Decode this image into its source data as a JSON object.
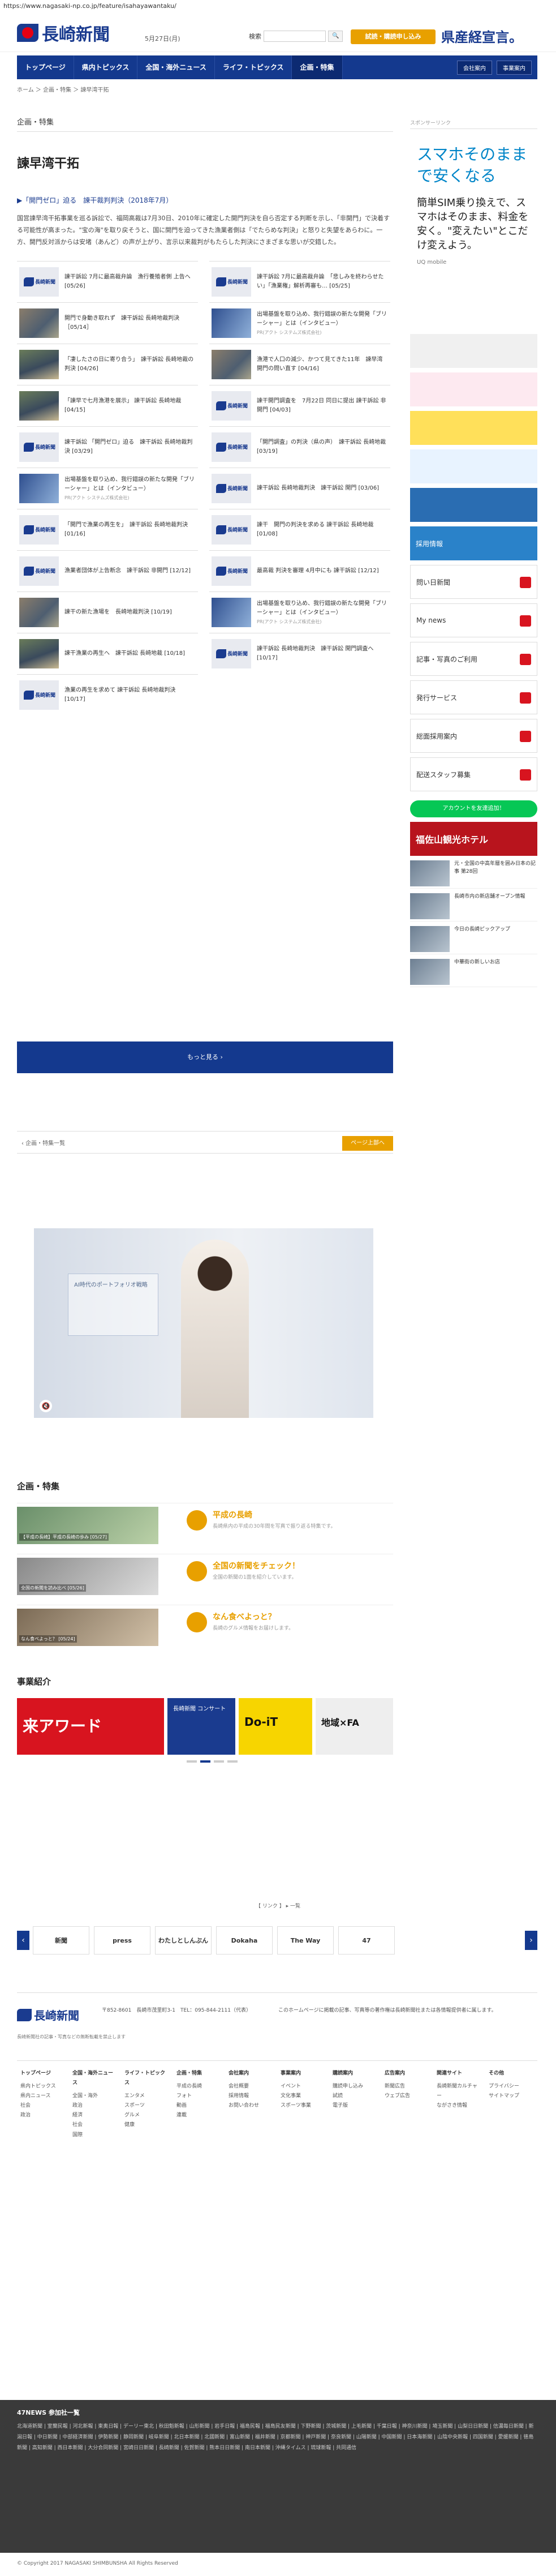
{
  "url": "https://www.nagasaki-np.co.jp/feature/isahayawantaku/",
  "header": {
    "logo": "長崎新聞",
    "date": "5月27日(月)",
    "search_placeholder": "",
    "search_label": "検索",
    "trial_label": "試読・購読申し込み",
    "kensan": "県産経宣言。"
  },
  "nav": {
    "items": [
      "トップページ",
      "県内トピックス",
      "全国・海外ニュース",
      "ライフ・トピックス",
      "企画・特集"
    ],
    "right": [
      "会社案内",
      "事業案内"
    ]
  },
  "breadcrumb": "ホーム ＞ 企画・特集 ＞ 諫早湾干拓",
  "main": {
    "section_label": "企画・特集",
    "page_title": "諫早湾干拓",
    "feature_title": "▶「開門ゼロ」迫る　諫干裁判判決（2018年7月）",
    "feature_desc": "国営諫早湾干拓事業を巡る訴訟で、福岡高裁は7月30日、2010年に確定した開門判決を自ら否定する判断を示し、「非開門」で決着する可能性が高まった。\"宝の海\"を取り戻そうと、国に開門を迫ってきた漁業者側は「でたらめな判決」と怒りと失望をあらわに。一方、開門反対派からは安堵（あんど）の声が上がり、言示以来裁判がもたらした判決にさまざまな思いが交錯した。"
  },
  "cards": [
    {
      "t": "諫干訴訟 7月に最高裁弁論　漁行養殖者側 上告へ [05/26]",
      "s": "",
      "th": "logo-th"
    },
    {
      "t": "諫干訴訟 7月に最高裁弁論　「悲しみを終わらせたい」「漁業権」解析再審も… [05/25]",
      "s": "",
      "th": "logo-th"
    },
    {
      "t": "開門で身動き取れず　諫干訴訟 長崎地裁判決 ［05/14］",
      "s": "",
      "th": "photo"
    },
    {
      "t": "出場基盤を取り込め、我行錯誤の新たな開発「ブリーシャー」とは（インタビュー）",
      "s": "PR(アクト システムズ株式会社)",
      "th": "ad"
    },
    {
      "t": "「凄したさの日に寄り合う」　諫干訴訟 長崎地裁の判決 [04/26]",
      "s": "",
      "th": "photo2"
    },
    {
      "t": "漁港で人口の減少、かつて見てきた11年　諫早湾 開門の問い直す [04/16]",
      "s": "",
      "th": "photo"
    },
    {
      "t": "「諫早で七月漁港を展示」 諫干訴訟 長崎地裁 [04/15]",
      "s": "",
      "th": "photo2"
    },
    {
      "t": "諫干開門調査を　7月22日 同日に提出 諫干訴訟 非開門 [04/03]",
      "s": "",
      "th": "logo-th"
    },
    {
      "t": "諫干訴訟 「開門ゼロ」迫る　諫干訴訟 長崎地裁判決 [03/29]",
      "s": "",
      "th": "logo-th"
    },
    {
      "t": "「開門調査」の判決（県の声）　諫干訴訟 長崎地裁 [03/19]",
      "s": "",
      "th": "logo-th"
    },
    {
      "t": "出場基盤を取り込め、我行錯誤の新たな開発「ブリーシャー」とは（インタビュー）",
      "s": "PR(アクト システムズ株式会社)",
      "th": "ad"
    },
    {
      "t": "諫干訴訟 長崎地裁判決　諫干訴訟 開門 [03/06]",
      "s": "",
      "th": "logo-th"
    },
    {
      "t": "「開門で漁業の再生を」　諫干訴訟 長崎地裁判決 [01/16]",
      "s": "",
      "th": "logo-th"
    },
    {
      "t": "諫干　開門の判決を求める 諫干訴訟 長崎地裁 [01/08]",
      "s": "",
      "th": "logo-th"
    },
    {
      "t": "漁業者団体が上告断念　諫干訴訟 非開門 [12/12]",
      "s": "",
      "th": "logo-th"
    },
    {
      "t": "最高裁 判決を審理 4月中にも 諫干訴訟 [12/12]",
      "s": "",
      "th": "logo-th"
    },
    {
      "t": "諫干の新た漁場を　長崎地裁判決 [10/19]",
      "s": "",
      "th": "photo"
    },
    {
      "t": "出場基盤を取り込め、我行錯誤の新たな開発「ブリーシャー」とは（インタビュー）",
      "s": "PR(アクト システムズ株式会社)",
      "th": "ad"
    },
    {
      "t": "諫干漁業の再生へ　諫干訴訟 長崎地裁 [10/18]",
      "s": "",
      "th": "photo2"
    },
    {
      "t": "諫干訴訟 長崎地裁判決　諫干訴訟 開門調査へ [10/17]",
      "s": "",
      "th": "logo-th"
    },
    {
      "t": "漁業の再生を求めて 諫干訴訟 長崎地裁判決 [10/17]",
      "s": "",
      "th": "logo-th"
    }
  ],
  "more_label": "もっと見る ›",
  "pager": {
    "prev": "‹ 企画・特集一覧",
    "next": "ページ上部へ"
  },
  "video": {
    "panel": "AI時代のポートフォリオ戦略"
  },
  "features": {
    "title": "企画・特集",
    "rows": [
      {
        "cap": "【平成の長崎】平成の長崎の歩み [05/27]",
        "title": "平成の長崎",
        "desc": "長崎県内の平成の30年間を写真で振り返る特集です。"
      },
      {
        "cap": "全国の新聞を読み比べ [05/26]",
        "title": "全国の新聞をチェック！",
        "desc": "全国の新聞の1面を紹介しています。"
      },
      {
        "cap": "なん食べよっと？ [05/24]",
        "title": "なん食べよっと？",
        "desc": "長崎のグルメ情報をお届けします。"
      }
    ]
  },
  "business": {
    "title": "事業紹介",
    "b1": "来アワード",
    "b2": "長崎新聞 コンサート",
    "b3": "Do-iT",
    "b4": "地域×FA"
  },
  "side": {
    "sponsor": "スポンサーリンク",
    "ad_title": "スマホそのままで安くなる",
    "ad_sub": "簡単SIM乗り換えで、スマホはそのまま、料金を安く。\"変えたい\"とこだけ変えよう。",
    "ad_brand": "UQ mobile",
    "boxes": [
      "採用情報",
      "問い日新聞",
      "My news",
      "記事・写真のご利用",
      "発行サービス",
      "総面採用案内",
      "配送スタッフ募集"
    ],
    "line": "アカウントを友達追加！",
    "hotel": "福佐山観光ホテル",
    "news": [
      {
        "t": "元・全国の中高年層を囲み日本の記事 第28回"
      },
      {
        "t": "長崎市内の新店舗オープン情報"
      },
      {
        "t": "今日の長崎ピックアップ"
      },
      {
        "t": "中華街の新しいお店"
      }
    ]
  },
  "logos": {
    "title": "【 リンク 】 ▸ 一覧",
    "items": [
      "新聞",
      "press",
      "わたしとしんぶん",
      "Dokaha",
      "The Way",
      "47"
    ]
  },
  "footer": {
    "logo": "長崎新聞",
    "addr": "〒852-8601　長崎市茂里町3-1　TEL：095-844-2111（代表）",
    "note": "長崎新聞社の記事・写真などの無断転載を禁止します",
    "right": "このホームページに掲載の記事、写真等の著作権は長崎新聞社または各情報提供者に属します。"
  },
  "sitemap": [
    {
      "h": "トップページ",
      "items": [
        "県内トピックス",
        "県内ニュース",
        "社会",
        "政治"
      ]
    },
    {
      "h": "全国・海外ニュース",
      "items": [
        "全国・海外",
        "政治",
        "経済",
        "社会",
        "国際"
      ]
    },
    {
      "h": "ライフ・トピックス",
      "items": [
        "エンタメ",
        "スポーツ",
        "グルメ",
        "健康"
      ]
    },
    {
      "h": "企画・特集",
      "items": [
        "平成の長崎",
        "フォト",
        "動画",
        "連載"
      ]
    },
    {
      "h": "会社案内",
      "items": [
        "会社概要",
        "採用情報",
        "お問い合わせ"
      ]
    },
    {
      "h": "事業案内",
      "items": [
        "イベント",
        "文化事業",
        "スポーツ事業"
      ]
    },
    {
      "h": "購読案内",
      "items": [
        "購読申し込み",
        "試読",
        "電子版"
      ]
    },
    {
      "h": "広告案内",
      "items": [
        "新聞広告",
        "ウェブ広告"
      ]
    },
    {
      "h": "関連サイト",
      "items": [
        "長崎新聞カルチャー",
        "ながさき情報"
      ]
    },
    {
      "h": "その他",
      "items": [
        "プライバシー",
        "サイトマップ"
      ]
    }
  ],
  "dark": {
    "title": "47NEWS 参加社一覧",
    "list": "北海道新聞 | 室蘭民報 | 河北新報 | 東奥日報 | デーリー東北 | 秋田魁新報 | 山形新聞 | 岩手日報 | 福島民報 | 福島民友新聞 | 下野新聞 | 茨城新聞 | 上毛新聞 | 千葉日報 | 神奈川新聞 | 埼玉新聞 | 山梨日日新聞 | 信濃毎日新聞 | 新潟日報 | 中日新聞 | 中部経済新聞 | 伊勢新聞 | 静岡新聞 | 岐阜新聞 | 北日本新聞 | 北國新聞 | 富山新聞 | 福井新聞 | 京都新聞 | 神戸新聞 | 奈良新聞 | 山陽新聞 | 中国新聞 | 日本海新聞 | 山陰中央新報 | 四国新聞 | 愛媛新聞 | 徳島新聞 | 高知新聞 | 西日本新聞 | 大分合同新聞 | 宮崎日日新聞 | 長崎新聞 | 佐賀新聞 | 熊本日日新聞 | 南日本新聞 | 沖縄タイムス | 琉球新報 | 共同通信"
  },
  "copyright": "© Copyright 2017 NAGASAKI SHIMBUNSHA All Rights Reserved"
}
